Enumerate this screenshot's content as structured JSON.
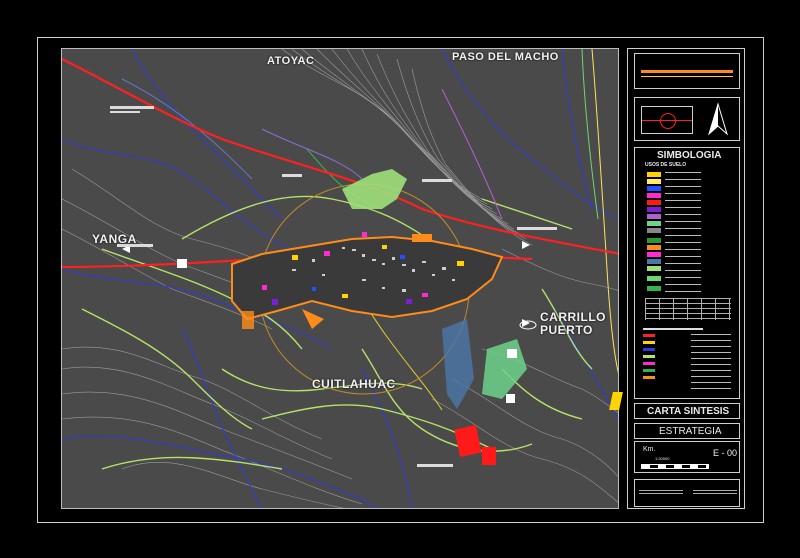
{
  "map": {
    "places": {
      "atoyac": "ATOYAC",
      "paso_del_macho": "PASO DEL MACHO",
      "yanga": "YANGA",
      "carrillo_puerto": "CARRILLO\nPUERTO",
      "cuitlahuac": "CUITLAHUAC"
    },
    "colors": {
      "background": "#4a4a4a",
      "road_main": "#ff2020",
      "contours": "#9a9a9a",
      "rivers": "#2d3cd6",
      "green_lines": "#b4e36a",
      "urban_orange": "#ff8c1a",
      "buffer_circle": "#c08a2a"
    }
  },
  "panel": {
    "legend_title": "SIMBOLOGIA",
    "legend_subtitle": "USOS DE SUELO",
    "plan_name": "CARTA SINTESIS",
    "stage_name": "ESTRATEGIA",
    "scale_unit": "Km.",
    "sheet_number": "E - 00",
    "scale_label": "1:20000"
  }
}
